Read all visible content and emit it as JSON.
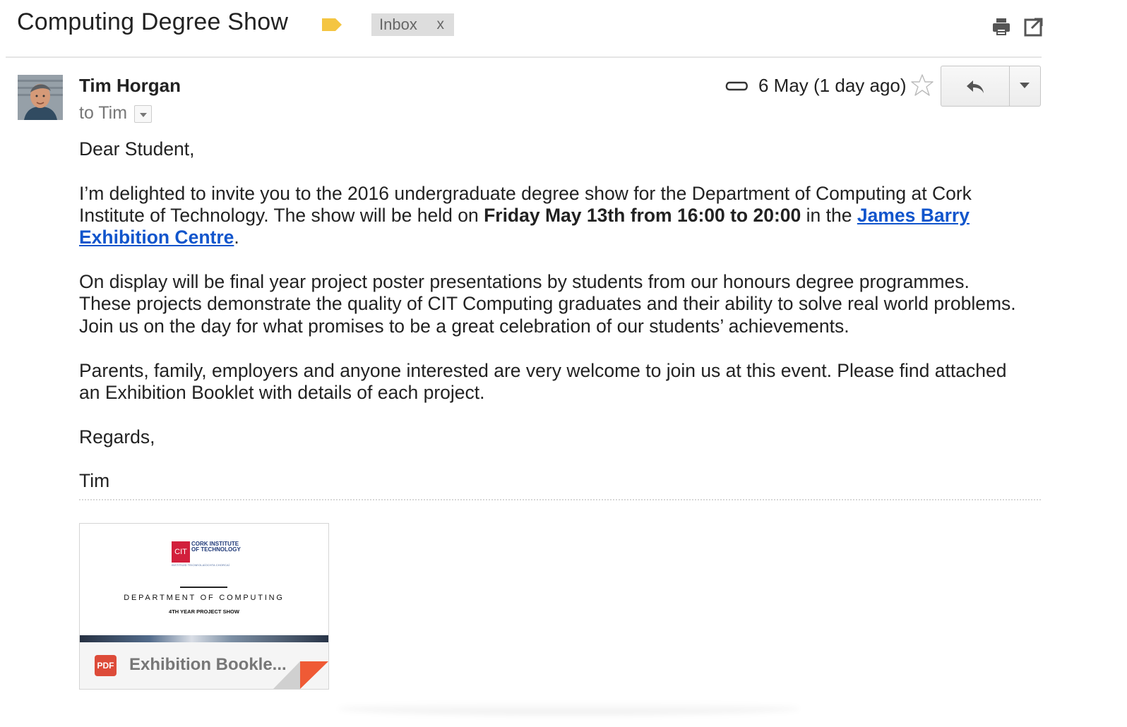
{
  "email": {
    "subject": "Computing Degree Show",
    "label_chip": {
      "text": "Inbox",
      "remove": "x"
    },
    "sender": "Tim Horgan",
    "recipient_line": "to Tim",
    "date": "6 May (1 day ago)",
    "body": {
      "greeting": "Dear Student,",
      "invite_prefix": "I’m delighted to invite you to the 2016 undergraduate degree show for the Department of Computing at Cork Institute of Technology. The show will be held on ",
      "invite_bold": "Friday May 13th from 16:00 to 20:00",
      "invite_middle": " in the ",
      "venue_link": "James Barry Exhibition Centre",
      "invite_suffix": ".",
      "display_paragraph": "On display will be final year project poster presentations by students from our honours degree programmes. These projects demonstrate the quality of CIT Computing graduates and their ability to solve real world problems. Join us on the day for what promises to be a great celebration of our students’ achievements.",
      "welcome_paragraph": "Parents, family, employers and anyone interested are very welcome to join us at this event. Please find attached an Exhibition Booklet with details of each project.",
      "closing": "Regards,",
      "signature": "Tim"
    },
    "attachment": {
      "badge": "PDF",
      "filename": "Exhibition Bookle...",
      "preview": {
        "logo_mark": "CIT",
        "institution": "CORK INSTITUTE OF TECHNOLOGY",
        "institution_irish": "INSTITIÚID TEICNEOLAÍOCHTA CHORCAÍ",
        "department": "DEPARTMENT OF COMPUTING",
        "show_title": "4TH YEAR PROJECT SHOW"
      }
    }
  },
  "colors": {
    "link": "#1155cc",
    "label_tag": "#f4c542",
    "pdf_badge": "#dd4b39",
    "cit_logo": "#d21f3c"
  },
  "icons": [
    "label-tag-icon",
    "print-icon",
    "pop-out-icon",
    "paperclip-icon",
    "star-icon",
    "reply-icon",
    "dropdown-icon"
  ]
}
